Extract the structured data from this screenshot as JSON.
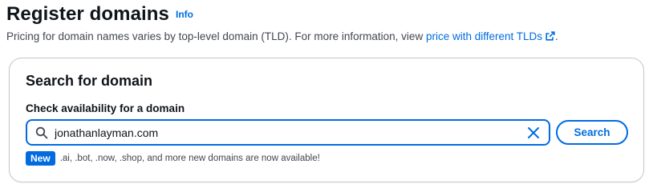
{
  "header": {
    "title": "Register domains",
    "info_link": "Info",
    "description_prefix": "Pricing for domain names varies by top-level domain (TLD). For more information, view ",
    "description_link": "price with different TLDs",
    "description_suffix": "."
  },
  "search_panel": {
    "title": "Search for domain",
    "field_label": "Check availability for a domain",
    "input_value": "jonathanlayman.com",
    "search_button": "Search",
    "badge": "New",
    "notice": ".ai, .bot, .now, .shop, and more new domains are now available!"
  },
  "icons": {
    "search": "search-icon",
    "clear": "close-icon",
    "external": "external-link-icon"
  },
  "colors": {
    "accent": "#006ce0",
    "text": "#0f141a",
    "secondary_text": "#424650",
    "border": "#c6c6cd"
  }
}
